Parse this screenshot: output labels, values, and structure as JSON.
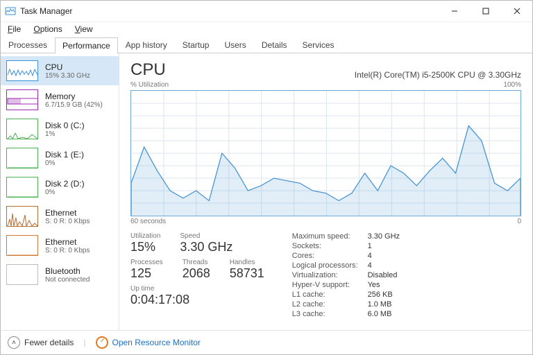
{
  "titlebar": {
    "title": "Task Manager"
  },
  "menu": {
    "items": [
      "File",
      "Options",
      "View"
    ]
  },
  "tabs": {
    "items": [
      "Processes",
      "Performance",
      "App history",
      "Startup",
      "Users",
      "Details",
      "Services"
    ],
    "active": 1
  },
  "sidebar": {
    "items": [
      {
        "title": "CPU",
        "sub": "15% 3.30 GHz",
        "color": "#3a8fd6",
        "kind": "cpu"
      },
      {
        "title": "Memory",
        "sub": "6.7/15.9 GB (42%)",
        "color": "#9c27b0",
        "kind": "mem"
      },
      {
        "title": "Disk 0 (C:)",
        "sub": "1%",
        "color": "#4caf50",
        "kind": "disk"
      },
      {
        "title": "Disk 1 (E:)",
        "sub": "0%",
        "color": "#4caf50",
        "kind": "disk0"
      },
      {
        "title": "Disk 2 (D:)",
        "sub": "0%",
        "color": "#4caf50",
        "kind": "disk0"
      },
      {
        "title": "Ethernet",
        "sub": "S: 0  R: 0 Kbps",
        "color": "#b56a2e",
        "kind": "net"
      },
      {
        "title": "Ethernet",
        "sub": "S: 0  R: 0 Kbps",
        "color": "#d07a36",
        "kind": "net0"
      },
      {
        "title": "Bluetooth",
        "sub": "Not connected",
        "color": "#bdbdbd",
        "kind": "blank"
      }
    ],
    "active": 0
  },
  "cpu": {
    "heading": "CPU",
    "model": "Intel(R) Core(TM) i5-2500K CPU @ 3.30GHz",
    "graph_label_left": "% Utilization",
    "graph_label_right": "100%",
    "graph_axis_left": "60 seconds",
    "graph_axis_right": "0",
    "metrics_left": [
      {
        "label": "Utilization",
        "value": "15%"
      },
      {
        "label": "Speed",
        "value": "3.30 GHz"
      },
      {
        "label": "Processes",
        "value": "125"
      },
      {
        "label": "Threads",
        "value": "2068"
      },
      {
        "label": "Handles",
        "value": "58731"
      },
      {
        "label": "Up time",
        "value": "0:04:17:08"
      }
    ],
    "metrics_right": [
      {
        "k": "Maximum speed:",
        "v": "3.30 GHz"
      },
      {
        "k": "Sockets:",
        "v": "1"
      },
      {
        "k": "Cores:",
        "v": "4"
      },
      {
        "k": "Logical processors:",
        "v": "4"
      },
      {
        "k": "Virtualization:",
        "v": "Disabled"
      },
      {
        "k": "Hyper-V support:",
        "v": "Yes"
      },
      {
        "k": "L1 cache:",
        "v": "256 KB"
      },
      {
        "k": "L2 cache:",
        "v": "1.0 MB"
      },
      {
        "k": "L3 cache:",
        "v": "6.0 MB"
      }
    ]
  },
  "footer": {
    "fewer": "Fewer details",
    "orm": "Open Resource Monitor"
  },
  "chart_data": {
    "type": "line",
    "title": "% Utilization",
    "xlabel": "60 seconds → 0",
    "ylabel": "% Utilization",
    "ylim": [
      0,
      100
    ],
    "x_seconds_ago": [
      60,
      58,
      56,
      54,
      52,
      50,
      48,
      46,
      44,
      42,
      40,
      38,
      36,
      34,
      32,
      30,
      28,
      26,
      24,
      22,
      20,
      18,
      16,
      14,
      12,
      10,
      8,
      6,
      4,
      2,
      0
    ],
    "values": [
      26,
      55,
      36,
      20,
      14,
      20,
      12,
      50,
      38,
      20,
      24,
      30,
      28,
      26,
      20,
      18,
      12,
      18,
      34,
      20,
      40,
      34,
      24,
      36,
      46,
      34,
      72,
      60,
      26,
      20,
      30
    ]
  }
}
